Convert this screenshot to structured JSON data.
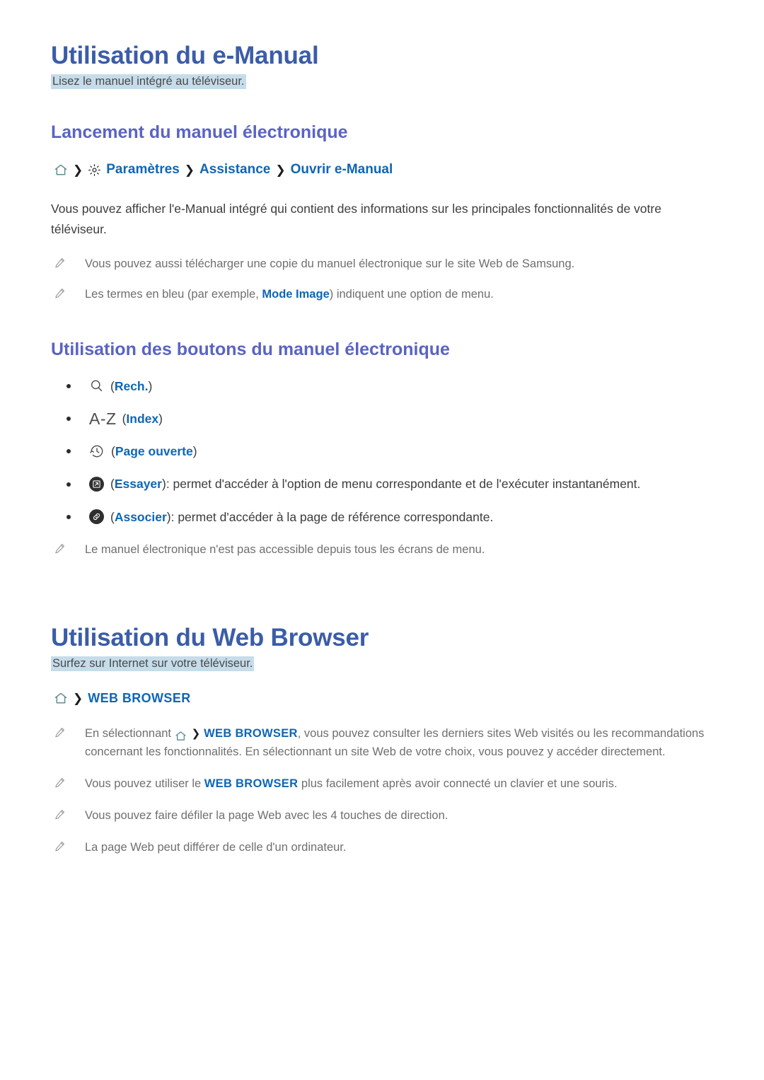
{
  "doc": {
    "sections": [
      {
        "title": "Utilisation du e-Manual",
        "subtitle": "Lisez le manuel intégré au téléviseur.",
        "section_heading": "Lancement du manuel électronique",
        "breadcrumb": {
          "home_icon": "home-icon",
          "gear_icon": "gear-icon",
          "separator": "❯",
          "items": [
            "Paramètres",
            "Assistance",
            "Ouvrir e-Manual"
          ]
        },
        "paragraph": "Vous pouvez afficher l'e-Manual intégré qui contient des informations sur les principales fonctionnalités de votre téléviseur.",
        "notes": [
          {
            "icon": "pencil-icon",
            "pre": "Vous pouvez aussi télécharger une copie du manuel électronique sur le site Web de Samsung.",
            "term": "",
            "post": ""
          },
          {
            "icon": "pencil-icon",
            "pre": "Les termes en bleu (par exemple, ",
            "term": "Mode Image",
            "post": ") indiquent une option de menu."
          }
        ],
        "buttons_heading": "Utilisation des boutons du manuel électronique",
        "buttons": [
          {
            "icon": "search-icon",
            "glyph": "",
            "open_paren": "(",
            "label": "Rech.",
            "close_paren": ")",
            "description": ""
          },
          {
            "icon": "az-index-icon",
            "glyph": "A-Z",
            "open_paren": "(",
            "label": "Index",
            "close_paren": ")",
            "description": ""
          },
          {
            "icon": "history-clock-icon",
            "glyph": "",
            "open_paren": "(",
            "label": "Page ouverte",
            "close_paren": ")",
            "description": ""
          },
          {
            "icon": "external-link-badge-icon",
            "glyph": "",
            "open_paren": "(",
            "label": "Essayer",
            "close_paren": ")",
            "description": " : permet d'accéder à l'option de menu correspondante et de l'exécuter instantanément."
          },
          {
            "icon": "link-chain-badge-icon",
            "glyph": "",
            "open_paren": "(",
            "label": "Associer",
            "close_paren": ")",
            "description": " : permet d'accéder à la page de référence correspondante."
          }
        ],
        "closing_note": {
          "icon": "pencil-icon",
          "text": "Le manuel électronique n'est pas accessible depuis tous les écrans de menu."
        }
      },
      {
        "title": "Utilisation du Web Browser",
        "subtitle": "Surfez sur Internet sur votre téléviseur.",
        "breadcrumb": {
          "home_icon": "home-icon",
          "separator": "❯",
          "items": [
            "WEB BROWSER"
          ]
        },
        "notes": [
          {
            "icon": "pencil-icon",
            "pre": "En sélectionnant ",
            "inline_home_icon": "home-icon",
            "inline_sep": "❯",
            "caps": "WEB BROWSER",
            "post": ", vous pouvez consulter les derniers sites Web visités ou les recommandations concernant les fonctionnalités. En sélectionnant un site Web de votre choix, vous pouvez y accéder directement."
          },
          {
            "icon": "pencil-icon",
            "pre": "Vous pouvez utiliser le ",
            "caps": "WEB BROWSER",
            "post": " plus facilement après avoir connecté un clavier et une souris."
          },
          {
            "icon": "pencil-icon",
            "pre": "Vous pouvez faire défiler la page Web avec les 4 touches de direction.",
            "caps": "",
            "post": ""
          },
          {
            "icon": "pencil-icon",
            "pre": "La page Web peut différer de celle d'un ordinateur.",
            "caps": "",
            "post": ""
          }
        ]
      }
    ]
  },
  "colors": {
    "title_blue": "#3b5ca8",
    "section_purple": "#5a63c4",
    "link_blue": "#0f66b3",
    "highlight": "#c6dcea",
    "body_gray": "#3c3c3c",
    "note_gray": "#6f6f6f",
    "badge_dark": "#2f2f2f",
    "home_icon_teal": "#5c8a91"
  }
}
